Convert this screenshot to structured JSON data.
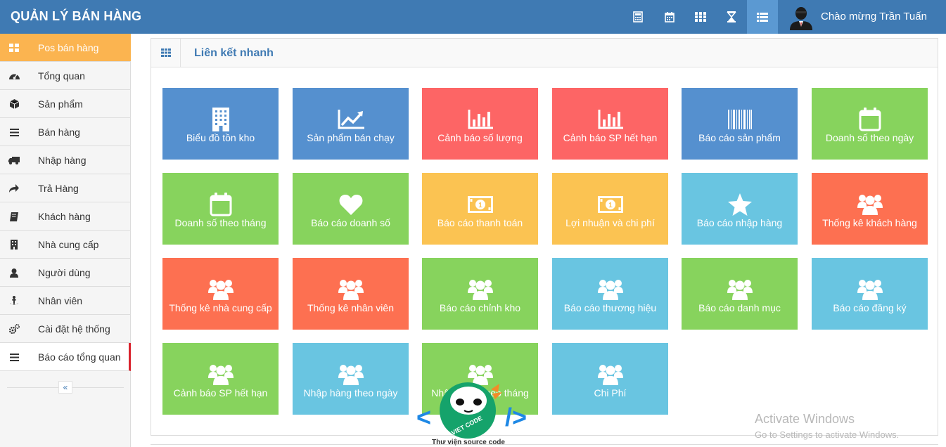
{
  "header": {
    "brand": "QUẢN LÝ BÁN HÀNG",
    "greeting": "Chào mừng Trần Tuấn",
    "icons": [
      "calculator-icon",
      "calendar-icon",
      "grid-icon",
      "hourglass-icon",
      "list-icon"
    ],
    "bg_color": "#3f7ab3"
  },
  "sidebar": {
    "items": [
      {
        "label": "Pos bán hàng",
        "icon": "pos-icon"
      },
      {
        "label": "Tổng quan",
        "icon": "dashboard-icon"
      },
      {
        "label": "Sản phẩm",
        "icon": "cube-icon"
      },
      {
        "label": "Bán hàng",
        "icon": "list-icon"
      },
      {
        "label": "Nhập hàng",
        "icon": "truck-icon"
      },
      {
        "label": "Trả Hàng",
        "icon": "share-icon"
      },
      {
        "label": "Khách hàng",
        "icon": "book-icon"
      },
      {
        "label": "Nhà cung cấp",
        "icon": "building-icon"
      },
      {
        "label": "Người dùng",
        "icon": "user-icon"
      },
      {
        "label": "Nhân viên",
        "icon": "anchor-icon"
      },
      {
        "label": "Cài đặt hệ thống",
        "icon": "cogs-icon"
      },
      {
        "label": "Báo cáo tổng quan",
        "icon": "list-icon"
      }
    ],
    "collapse": "«",
    "active_color": "#fbb450"
  },
  "panel": {
    "title": "Liên kết nhanh"
  },
  "tiles": [
    {
      "label": "Biểu đồ tồn kho",
      "icon": "building-icon",
      "color": "#5590cf"
    },
    {
      "label": "Sản phẩm bán chạy",
      "icon": "line-chart-icon",
      "color": "#5590cf"
    },
    {
      "label": "Cảnh báo số lượng",
      "icon": "bar-chart-icon",
      "color": "#fd6565"
    },
    {
      "label": "Cảnh báo SP hết hạn",
      "icon": "bar-chart-icon",
      "color": "#fd6565"
    },
    {
      "label": "Báo cáo sản phẩm",
      "icon": "barcode-icon",
      "color": "#5590cf"
    },
    {
      "label": "Doanh số theo ngày",
      "icon": "calendar-icon",
      "color": "#87d35d"
    },
    {
      "label": "Doanh số theo tháng",
      "icon": "calendar-icon",
      "color": "#87d35d"
    },
    {
      "label": "Báo cáo doanh số",
      "icon": "heart-icon",
      "color": "#87d35d"
    },
    {
      "label": "Báo cáo thanh toán",
      "icon": "money-icon",
      "color": "#fbc352"
    },
    {
      "label": "Lợi nhuận và chi phí",
      "icon": "money-icon",
      "color": "#fbc352"
    },
    {
      "label": "Báo cáo nhập hàng",
      "icon": "star-icon",
      "color": "#69c5e1"
    },
    {
      "label": "Thống kê khách hàng",
      "icon": "users-icon",
      "color": "#fd7051"
    },
    {
      "label": "Thống kê nhà cung cấp",
      "icon": "users-icon",
      "color": "#fd7051"
    },
    {
      "label": "Thống kê nhân viên",
      "icon": "users-icon",
      "color": "#fd7051"
    },
    {
      "label": "Báo cáo chỉnh kho",
      "icon": "users-icon",
      "color": "#87d35d"
    },
    {
      "label": "Báo cáo thương hiệu",
      "icon": "users-icon",
      "color": "#69c5e1"
    },
    {
      "label": "Báo cáo danh mục",
      "icon": "users-icon",
      "color": "#87d35d"
    },
    {
      "label": "Báo cáo đăng ký",
      "icon": "users-icon",
      "color": "#69c5e1"
    },
    {
      "label": "Cảnh báo SP hết hạn",
      "icon": "users-icon",
      "color": "#87d35d"
    },
    {
      "label": "Nhập hàng theo ngày",
      "icon": "users-icon",
      "color": "#69c5e1"
    },
    {
      "label": "Nhập hàng theo tháng",
      "icon": "users-icon",
      "color": "#87d35d"
    },
    {
      "label": "Chi Phí",
      "icon": "users-icon",
      "color": "#69c5e1"
    }
  ],
  "watermark": {
    "title": "Activate Windows",
    "subtitle": "Go to Settings to activate Windows.",
    "logo_text": "VIET CODE",
    "logo_caption": "Thư viện source code"
  }
}
